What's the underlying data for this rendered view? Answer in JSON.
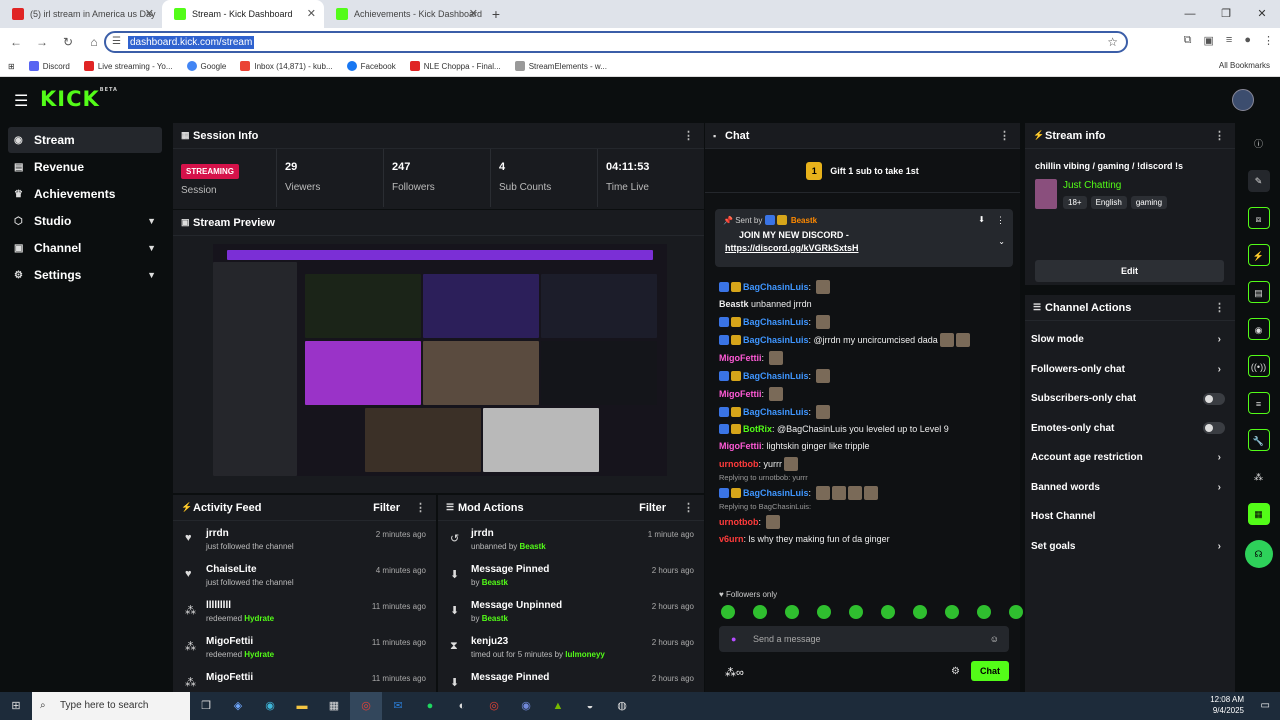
{
  "browser": {
    "tabs": [
      {
        "title": "(5) irl stream in America us Day",
        "favicon": "youtube"
      },
      {
        "title": "Stream - Kick Dashboard",
        "favicon": "kick"
      },
      {
        "title": "Achievements - Kick Dashboard",
        "favicon": "kick"
      }
    ],
    "url": "dashboard.kick.com/stream",
    "bookmarks": [
      "Discord",
      "Live streaming - Yo...",
      "Google",
      "Inbox (14,871) - kub...",
      "Facebook",
      "NLE Choppa - Final...",
      "StreamElements - w..."
    ],
    "all_bookmarks": "All Bookmarks"
  },
  "sidebar": {
    "items": [
      {
        "label": "Stream"
      },
      {
        "label": "Revenue"
      },
      {
        "label": "Achievements"
      },
      {
        "label": "Studio"
      },
      {
        "label": "Channel"
      },
      {
        "label": "Settings"
      }
    ]
  },
  "session": {
    "title": "Session Info",
    "status": "STREAMING",
    "status_label": "Session",
    "stats": [
      {
        "value": "29",
        "label": "Viewers"
      },
      {
        "value": "247",
        "label": "Followers"
      },
      {
        "value": "4",
        "label": "Sub Counts"
      },
      {
        "value": "04:11:53",
        "label": "Time Live"
      }
    ]
  },
  "preview": {
    "title": "Stream Preview"
  },
  "activity": {
    "title": "Activity Feed",
    "filter": "Filter",
    "items": [
      {
        "name": "jrrdn",
        "sub": "just followed the channel",
        "green": "",
        "time": "2 minutes ago",
        "icon": "heart-icon"
      },
      {
        "name": "ChaiseLite",
        "sub": "just followed the channel",
        "green": "",
        "time": "4 minutes ago",
        "icon": "heart-icon"
      },
      {
        "name": "lllllllll",
        "sub": "redeemed",
        "green": "Hydrate",
        "time": "11 minutes ago",
        "icon": "points-icon"
      },
      {
        "name": "MigoFettii",
        "sub": "redeemed",
        "green": "Hydrate",
        "time": "11 minutes ago",
        "icon": "points-icon"
      },
      {
        "name": "MigoFettii",
        "sub": "",
        "green": "",
        "time": "11 minutes ago",
        "icon": "points-icon"
      }
    ]
  },
  "mod": {
    "title": "Mod Actions",
    "filter": "Filter",
    "items": [
      {
        "name": "jrrdn",
        "sub": "unbanned by",
        "green": "Beastk",
        "time": "1 minute ago",
        "icon": "undo-icon"
      },
      {
        "name": "Message Pinned",
        "sub": "by",
        "green": "Beastk",
        "time": "2 hours ago",
        "icon": "pin-icon"
      },
      {
        "name": "Message Unpinned",
        "sub": "by",
        "green": "Beastk",
        "time": "2 hours ago",
        "icon": "pin-icon"
      },
      {
        "name": "kenju23",
        "sub": "timed out for 5 minutes by",
        "green": "lulmoneyy",
        "time": "2 hours ago",
        "icon": "hourglass-icon"
      },
      {
        "name": "Message Pinned",
        "sub": "",
        "green": "",
        "time": "2 hours ago",
        "icon": "pin-icon"
      }
    ]
  },
  "chat": {
    "title": "Chat",
    "gift_count": "1",
    "gift_text": "Gift 1 sub to take 1st",
    "pinned": {
      "sent_by": "Sent by",
      "user": "Beastk",
      "line1": "JOIN MY NEW DISCORD -",
      "line2": "https://discord.gg/kVGRkSxtsH"
    },
    "messages": [
      {
        "user": "BagChasinLuis",
        "cls": "u-blue",
        "badges": 2,
        "text": "",
        "emotes": 1
      },
      {
        "user": "Beastk",
        "cls": "",
        "badges": 0,
        "text": "unbanned jrrdn",
        "emotes": 0
      },
      {
        "user": "BagChasinLuis",
        "cls": "u-blue",
        "badges": 2,
        "text": "",
        "emotes": 1
      },
      {
        "user": "BagChasinLuis",
        "cls": "u-blue",
        "badges": 2,
        "text": "@jrrdn my uncircumcised dada",
        "emotes": 2
      },
      {
        "user": "MigoFettii",
        "cls": "u-pink",
        "badges": 0,
        "text": "",
        "emotes": 1
      },
      {
        "user": "BagChasinLuis",
        "cls": "u-blue",
        "badges": 2,
        "text": "",
        "emotes": 1
      },
      {
        "user": "MigoFettii",
        "cls": "u-pink",
        "badges": 0,
        "text": "",
        "emotes": 1
      },
      {
        "user": "BagChasinLuis",
        "cls": "u-blue",
        "badges": 2,
        "text": "",
        "emotes": 1
      },
      {
        "user": "BotRix",
        "cls": "u-green",
        "badges": 2,
        "text": "@BagChasinLuis you leveled up to Level 9",
        "emotes": 0
      },
      {
        "user": "MigoFettii",
        "cls": "u-pink",
        "badges": 0,
        "text": "lightskin ginger like tripple",
        "emotes": 0
      },
      {
        "user": "urnotbob",
        "cls": "u-red",
        "badges": 0,
        "text": "yurrr",
        "emotes": 1
      },
      {
        "user": "BagChasinLuis",
        "cls": "u-blue",
        "badges": 2,
        "text": "",
        "emotes": 4,
        "reply": "Replying to urnotbob: yurrr"
      },
      {
        "user": "urnotbob",
        "cls": "u-red",
        "badges": 0,
        "text": "",
        "emotes": 1,
        "reply": "Replying to BagChasinLuis:"
      },
      {
        "user": "v6urn",
        "cls": "u-red",
        "badges": 0,
        "text": "ls why they making fun of da ginger",
        "emotes": 0
      }
    ],
    "followers_only": "Followers only",
    "input_placeholder": "Send a message",
    "send_label": "Chat"
  },
  "stream_info": {
    "title": "Stream info",
    "stream_title": "chillin vibing / gaming / !discord !s",
    "category": "Just Chatting",
    "tags": [
      "18+",
      "English",
      "gaming"
    ],
    "edit_label": "Edit"
  },
  "channel_actions": {
    "title": "Channel Actions",
    "items": [
      {
        "label": "Slow mode",
        "control": "chevron"
      },
      {
        "label": "Followers-only chat",
        "control": "chevron"
      },
      {
        "label": "Subscribers-only chat",
        "control": "toggle"
      },
      {
        "label": "Emotes-only chat",
        "control": "toggle"
      },
      {
        "label": "Account age restriction",
        "control": "chevron"
      },
      {
        "label": "Banned words",
        "control": "chevron"
      },
      {
        "label": "Host Channel",
        "control": "none"
      },
      {
        "label": "Set goals",
        "control": "chevron"
      }
    ]
  },
  "taskbar": {
    "search_placeholder": "Type here to search",
    "time": "12:08 AM",
    "date": "9/4/2025"
  },
  "colors": {
    "kick_green": "#53fc18",
    "streaming_red": "#d6124a",
    "panel": "#191b1f"
  }
}
